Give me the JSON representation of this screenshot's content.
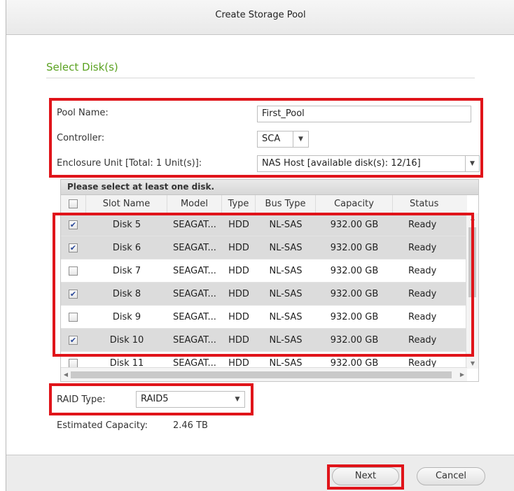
{
  "window": {
    "title": "Create Storage Pool"
  },
  "section": {
    "title": "Select Disk(s)"
  },
  "form": {
    "pool_name_label": "Pool Name:",
    "pool_name_value": "First_Pool",
    "controller_label": "Controller:",
    "controller_value": "SCA",
    "enclosure_label": "Enclosure Unit [Total: 1 Unit(s)]:",
    "enclosure_value": "NAS Host [available disk(s): 12/16]"
  },
  "disk_table": {
    "banner": "Please select at least one disk.",
    "columns": [
      "Slot Name",
      "Model",
      "Type",
      "Bus Type",
      "Capacity",
      "Status"
    ],
    "rows": [
      {
        "checked": true,
        "slot": "Disk 5",
        "model": "SEAGAT...",
        "type": "HDD",
        "bus": "NL-SAS",
        "capacity": "932.00 GB",
        "status": "Ready"
      },
      {
        "checked": true,
        "slot": "Disk 6",
        "model": "SEAGAT...",
        "type": "HDD",
        "bus": "NL-SAS",
        "capacity": "932.00 GB",
        "status": "Ready"
      },
      {
        "checked": false,
        "slot": "Disk 7",
        "model": "SEAGAT...",
        "type": "HDD",
        "bus": "NL-SAS",
        "capacity": "932.00 GB",
        "status": "Ready"
      },
      {
        "checked": true,
        "slot": "Disk 8",
        "model": "SEAGAT...",
        "type": "HDD",
        "bus": "NL-SAS",
        "capacity": "932.00 GB",
        "status": "Ready"
      },
      {
        "checked": false,
        "slot": "Disk 9",
        "model": "SEAGAT...",
        "type": "HDD",
        "bus": "NL-SAS",
        "capacity": "932.00 GB",
        "status": "Ready"
      },
      {
        "checked": true,
        "slot": "Disk 10",
        "model": "SEAGAT...",
        "type": "HDD",
        "bus": "NL-SAS",
        "capacity": "932.00 GB",
        "status": "Ready"
      },
      {
        "checked": false,
        "slot": "Disk 11",
        "model": "SEAGAT...",
        "type": "HDD",
        "bus": "NL-SAS",
        "capacity": "932.00 GB",
        "status": "Ready"
      }
    ]
  },
  "raid": {
    "label": "RAID Type:",
    "value": "RAID5"
  },
  "capacity": {
    "label": "Estimated Capacity:",
    "value": "2.46 TB"
  },
  "buttons": {
    "next": "Next",
    "cancel": "Cancel"
  },
  "colors": {
    "highlight": "#e0141a",
    "section_title": "#5ba222",
    "selected_row": "#dcdcdc"
  },
  "icons": {
    "dropdown": "chevron-down-icon",
    "checkbox_checked": "check-icon"
  }
}
